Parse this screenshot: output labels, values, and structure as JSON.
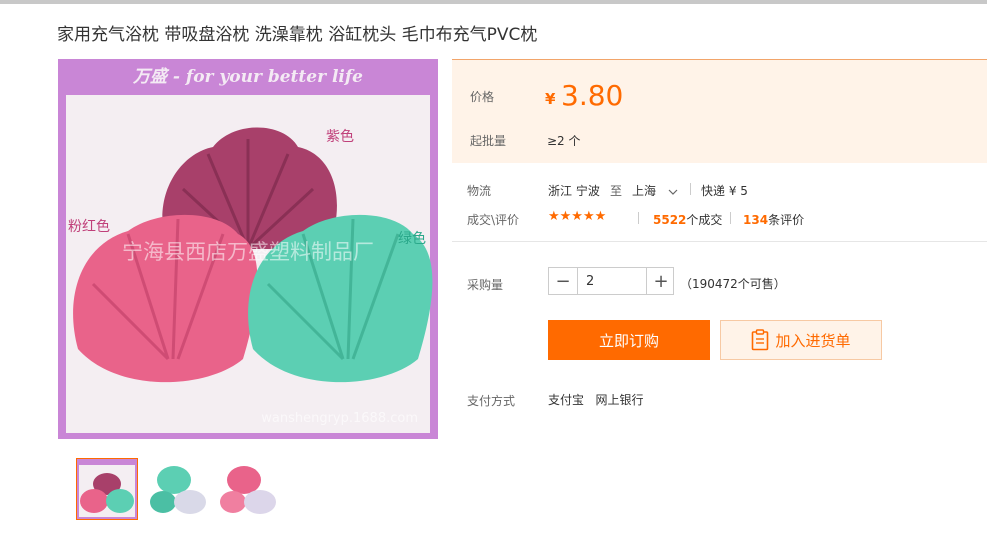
{
  "product": {
    "title": "家用充气浴枕 带吸盘浴枕 洗澡靠枕 浴缸枕头 毛巾布充气PVC枕"
  },
  "gallery": {
    "main": {
      "banner_text": "万盛 - for your better life",
      "label_purple": "紫色",
      "label_pink": "粉红色",
      "label_green": "绿色",
      "watermark_cn": "宁海县西店万盛塑料制品厂",
      "watermark_url": "wanshengryp.1688.com"
    },
    "thumbnails": [
      "thumb-1",
      "thumb-2",
      "thumb-3"
    ],
    "selected_index": 0
  },
  "pricing": {
    "price_label": "价格",
    "currency": "¥",
    "price": "3.80",
    "moq_label": "起批量",
    "moq": "≥2 个"
  },
  "logistics": {
    "label": "物流",
    "origin": "浙江 宁波",
    "to": "至",
    "destination": "上海",
    "shipping": "快递 ¥ 5"
  },
  "deals": {
    "label": "成交\\评价",
    "stars": "★★★★★",
    "deal_count": "5522",
    "deal_suffix": "个成交",
    "review_count": "134",
    "review_suffix": "条评价"
  },
  "purchase": {
    "qty_label": "采购量",
    "qty_value": "2",
    "minus": "−",
    "plus": "+",
    "available": "（190472个可售）",
    "buy_label": "立即订购",
    "cart_label": "加入进货单"
  },
  "payment": {
    "label": "支付方式",
    "methods": "支付宝   网上银行"
  },
  "colors": {
    "accent": "#ff6a00",
    "price_bg": "#fff3e8",
    "frame_purple": "#c986d6",
    "pink": "#e9638a",
    "purple": "#a8406a",
    "teal": "#5ccfb3"
  }
}
